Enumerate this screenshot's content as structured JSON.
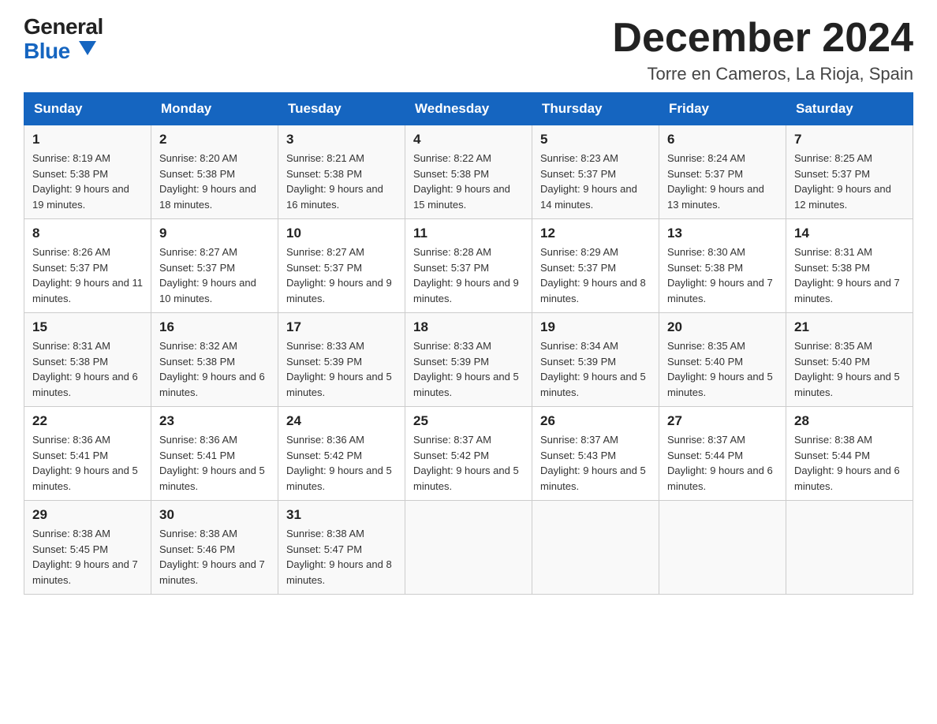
{
  "header": {
    "title": "December 2024",
    "subtitle": "Torre en Cameros, La Rioja, Spain",
    "logo_general": "General",
    "logo_blue": "Blue"
  },
  "calendar": {
    "days_of_week": [
      "Sunday",
      "Monday",
      "Tuesday",
      "Wednesday",
      "Thursday",
      "Friday",
      "Saturday"
    ],
    "weeks": [
      [
        {
          "day": "1",
          "sunrise": "8:19 AM",
          "sunset": "5:38 PM",
          "daylight": "9 hours and 19 minutes."
        },
        {
          "day": "2",
          "sunrise": "8:20 AM",
          "sunset": "5:38 PM",
          "daylight": "9 hours and 18 minutes."
        },
        {
          "day": "3",
          "sunrise": "8:21 AM",
          "sunset": "5:38 PM",
          "daylight": "9 hours and 16 minutes."
        },
        {
          "day": "4",
          "sunrise": "8:22 AM",
          "sunset": "5:38 PM",
          "daylight": "9 hours and 15 minutes."
        },
        {
          "day": "5",
          "sunrise": "8:23 AM",
          "sunset": "5:37 PM",
          "daylight": "9 hours and 14 minutes."
        },
        {
          "day": "6",
          "sunrise": "8:24 AM",
          "sunset": "5:37 PM",
          "daylight": "9 hours and 13 minutes."
        },
        {
          "day": "7",
          "sunrise": "8:25 AM",
          "sunset": "5:37 PM",
          "daylight": "9 hours and 12 minutes."
        }
      ],
      [
        {
          "day": "8",
          "sunrise": "8:26 AM",
          "sunset": "5:37 PM",
          "daylight": "9 hours and 11 minutes."
        },
        {
          "day": "9",
          "sunrise": "8:27 AM",
          "sunset": "5:37 PM",
          "daylight": "9 hours and 10 minutes."
        },
        {
          "day": "10",
          "sunrise": "8:27 AM",
          "sunset": "5:37 PM",
          "daylight": "9 hours and 9 minutes."
        },
        {
          "day": "11",
          "sunrise": "8:28 AM",
          "sunset": "5:37 PM",
          "daylight": "9 hours and 9 minutes."
        },
        {
          "day": "12",
          "sunrise": "8:29 AM",
          "sunset": "5:37 PM",
          "daylight": "9 hours and 8 minutes."
        },
        {
          "day": "13",
          "sunrise": "8:30 AM",
          "sunset": "5:38 PM",
          "daylight": "9 hours and 7 minutes."
        },
        {
          "day": "14",
          "sunrise": "8:31 AM",
          "sunset": "5:38 PM",
          "daylight": "9 hours and 7 minutes."
        }
      ],
      [
        {
          "day": "15",
          "sunrise": "8:31 AM",
          "sunset": "5:38 PM",
          "daylight": "9 hours and 6 minutes."
        },
        {
          "day": "16",
          "sunrise": "8:32 AM",
          "sunset": "5:38 PM",
          "daylight": "9 hours and 6 minutes."
        },
        {
          "day": "17",
          "sunrise": "8:33 AM",
          "sunset": "5:39 PM",
          "daylight": "9 hours and 5 minutes."
        },
        {
          "day": "18",
          "sunrise": "8:33 AM",
          "sunset": "5:39 PM",
          "daylight": "9 hours and 5 minutes."
        },
        {
          "day": "19",
          "sunrise": "8:34 AM",
          "sunset": "5:39 PM",
          "daylight": "9 hours and 5 minutes."
        },
        {
          "day": "20",
          "sunrise": "8:35 AM",
          "sunset": "5:40 PM",
          "daylight": "9 hours and 5 minutes."
        },
        {
          "day": "21",
          "sunrise": "8:35 AM",
          "sunset": "5:40 PM",
          "daylight": "9 hours and 5 minutes."
        }
      ],
      [
        {
          "day": "22",
          "sunrise": "8:36 AM",
          "sunset": "5:41 PM",
          "daylight": "9 hours and 5 minutes."
        },
        {
          "day": "23",
          "sunrise": "8:36 AM",
          "sunset": "5:41 PM",
          "daylight": "9 hours and 5 minutes."
        },
        {
          "day": "24",
          "sunrise": "8:36 AM",
          "sunset": "5:42 PM",
          "daylight": "9 hours and 5 minutes."
        },
        {
          "day": "25",
          "sunrise": "8:37 AM",
          "sunset": "5:42 PM",
          "daylight": "9 hours and 5 minutes."
        },
        {
          "day": "26",
          "sunrise": "8:37 AM",
          "sunset": "5:43 PM",
          "daylight": "9 hours and 5 minutes."
        },
        {
          "day": "27",
          "sunrise": "8:37 AM",
          "sunset": "5:44 PM",
          "daylight": "9 hours and 6 minutes."
        },
        {
          "day": "28",
          "sunrise": "8:38 AM",
          "sunset": "5:44 PM",
          "daylight": "9 hours and 6 minutes."
        }
      ],
      [
        {
          "day": "29",
          "sunrise": "8:38 AM",
          "sunset": "5:45 PM",
          "daylight": "9 hours and 7 minutes."
        },
        {
          "day": "30",
          "sunrise": "8:38 AM",
          "sunset": "5:46 PM",
          "daylight": "9 hours and 7 minutes."
        },
        {
          "day": "31",
          "sunrise": "8:38 AM",
          "sunset": "5:47 PM",
          "daylight": "9 hours and 8 minutes."
        },
        null,
        null,
        null,
        null
      ]
    ]
  }
}
